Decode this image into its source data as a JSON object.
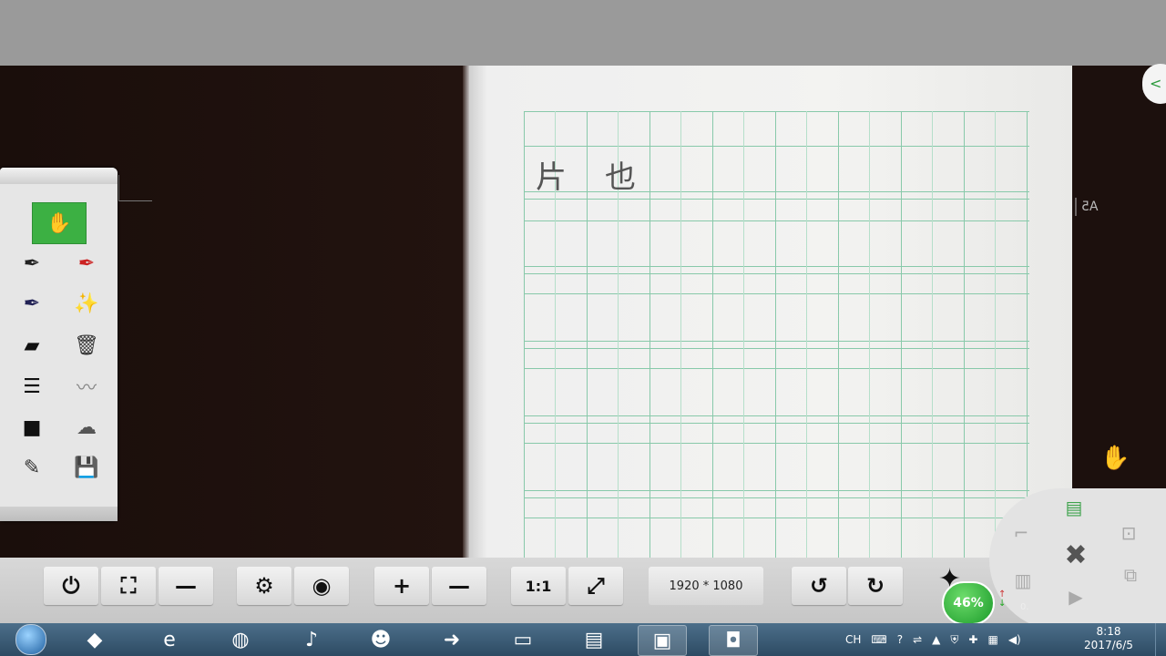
{
  "document": {
    "characters": [
      "片",
      "也"
    ],
    "paper_mark": "A5"
  },
  "toolbox": {
    "tools": [
      {
        "name": "hand-tool",
        "icon": "hand-icon",
        "glyph": "✋",
        "active": true
      },
      {
        "name": "pen-black",
        "icon": "pen-black-icon",
        "glyph": "✒"
      },
      {
        "name": "pen-red",
        "icon": "pen-red-icon",
        "glyph": "✒"
      },
      {
        "name": "pen-blue",
        "icon": "pen-blue-icon",
        "glyph": "✒"
      },
      {
        "name": "magic-wand",
        "icon": "magic-wand-icon",
        "glyph": "✨"
      },
      {
        "name": "eraser",
        "icon": "eraser-icon",
        "glyph": "▰"
      },
      {
        "name": "clear-all",
        "icon": "trash-icon",
        "glyph": "🗑"
      },
      {
        "name": "line-thick",
        "icon": "line-width-icon",
        "glyph": "☰"
      },
      {
        "name": "line-style",
        "icon": "line-style-icon",
        "glyph": "〰"
      },
      {
        "name": "rectangle",
        "icon": "rectangle-icon",
        "glyph": "■"
      },
      {
        "name": "shapes",
        "icon": "cloud-icon",
        "glyph": "☁"
      },
      {
        "name": "image-edit",
        "icon": "image-edit-icon",
        "glyph": "✎"
      },
      {
        "name": "save",
        "icon": "save-icon",
        "glyph": "💾"
      }
    ]
  },
  "control_bar": {
    "buttons": {
      "power": "⏻",
      "fullscreen": "⛶",
      "minimize": "—",
      "settings": "⚙",
      "camera": "◉",
      "zoom_in": "+",
      "zoom_out": "—",
      "one_to_one": "1:1",
      "fit": "⤢",
      "rotate_left": "↺",
      "rotate_right": "↻"
    },
    "resolution": "1920 * 1080"
  },
  "circle_menu": {
    "cpu_percent": "46%",
    "upload_arrow": "↑",
    "download_arrow": "↓",
    "net_value": "0."
  },
  "taskbar": {
    "apps": [
      {
        "name": "taskbar-app-qq-browser",
        "icon": "qq-browser-icon",
        "glyph": "◆"
      },
      {
        "name": "taskbar-app-ie",
        "icon": "internet-explorer-icon",
        "glyph": "e"
      },
      {
        "name": "taskbar-app-360",
        "icon": "360-browser-icon",
        "glyph": "◍"
      },
      {
        "name": "taskbar-app-kuwo",
        "icon": "music-icon",
        "glyph": "♪"
      },
      {
        "name": "taskbar-app-qq",
        "icon": "qq-penguin-icon",
        "glyph": "☻"
      },
      {
        "name": "taskbar-app-green",
        "icon": "green-arrow-icon",
        "glyph": "➜"
      },
      {
        "name": "taskbar-app-ppt",
        "icon": "presentation-icon",
        "glyph": "▭"
      },
      {
        "name": "taskbar-app-explorer",
        "icon": "folder-icon",
        "glyph": "▤"
      },
      {
        "name": "taskbar-app-tv",
        "icon": "tv-app-icon",
        "glyph": "▣",
        "active": true
      },
      {
        "name": "taskbar-app-camera",
        "icon": "camera-app-icon",
        "glyph": "◘",
        "active": true
      }
    ],
    "tray": {
      "language": "CH",
      "keyboard": "⌨",
      "help": "?",
      "usb": "⇌",
      "arrow": "▲",
      "shield": "⛨",
      "plugin": "✚",
      "network": "▦",
      "volume": "◀)"
    },
    "clock": {
      "time": "8:18",
      "date": "2017/6/5"
    }
  },
  "colors": {
    "accent_green": "#3cb043",
    "grid_line": "#88c9aa",
    "panel_bg": "#e6e6e6",
    "taskbar": "#2d4b63"
  }
}
